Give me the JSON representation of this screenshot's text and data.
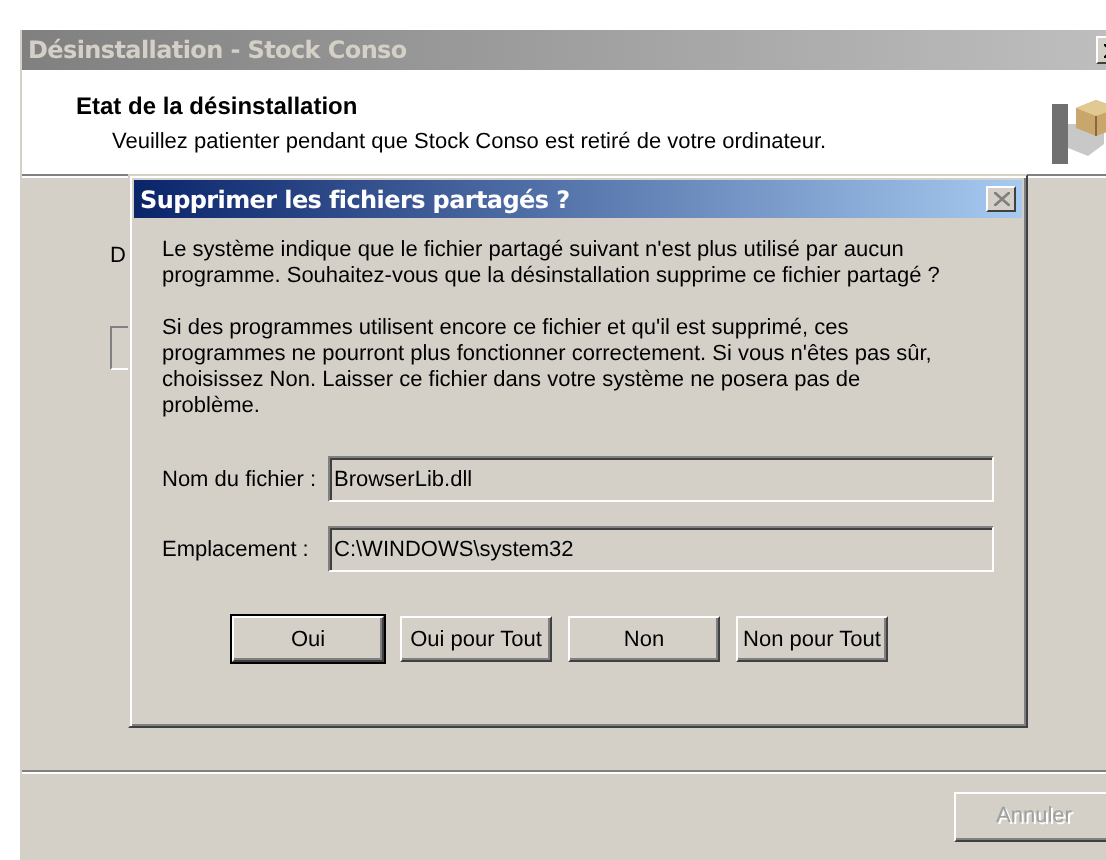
{
  "window": {
    "title": "Désinstallation - Stock Conso",
    "heading": "Etat de la désinstallation",
    "subheading": "Veuillez patienter pendant que Stock Conso est retiré de votre ordinateur.",
    "status_label": "D",
    "progress": {
      "level": 0
    },
    "cancel_button": {
      "label": "Annuler",
      "disabled": true
    }
  },
  "dialog": {
    "title": "Supprimer les fichiers partagés ?",
    "paragraphs": [
      "Le système indique que le fichier partagé suivant n'est plus utilisé par aucun programme. Souhaitez-vous que la désinstallation supprime ce fichier partagé ?",
      "Si des programmes utilisent encore ce fichier et qu'il est supprimé, ces programmes ne pourront plus fonctionner correctement. Si vous n'êtes pas sûr, choisissez Non. Laisser ce fichier dans votre système ne posera pas de problème."
    ],
    "fields": [
      {
        "label": "Nom du fichier :",
        "value": "BrowserLib.dll"
      },
      {
        "label": "Emplacement :",
        "value": "C:\\WINDOWS\\system32"
      }
    ],
    "buttons": [
      {
        "label": "Oui",
        "default": true
      },
      {
        "label": "Oui pour Tout",
        "default": false
      },
      {
        "label": "Non",
        "default": false
      },
      {
        "label": "Non pour Tout",
        "default": false
      }
    ]
  }
}
